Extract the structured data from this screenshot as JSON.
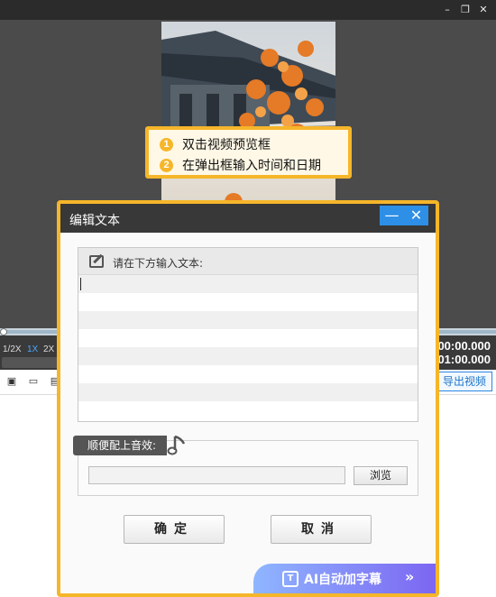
{
  "window": {
    "minimize_glyph": "–",
    "restore_glyph": "❐",
    "close_glyph": "✕"
  },
  "tip": {
    "steps": [
      {
        "num": "1",
        "text": "双击视频预览框"
      },
      {
        "num": "2",
        "text": "在弹出框输入时间和日期"
      }
    ],
    "accent_color": "#f6b62a"
  },
  "player": {
    "speeds": [
      "1/2X",
      "1X",
      "2X"
    ],
    "active_speed": "1X",
    "timecode_current": "00:00.000",
    "timecode_total": "01:00.000",
    "export_label": "导出视频"
  },
  "dialog": {
    "title": "编辑文本",
    "minimize_glyph": "—",
    "close_glyph": "✕",
    "text_prompt": "请在下方输入文本:",
    "text_value": "",
    "audio_label": "顺便配上音效:",
    "audio_value": "",
    "browse_label": "浏览",
    "ok_label": "确定",
    "cancel_label": "取消",
    "ai_label": "AI自动加字幕",
    "ai_icon_text": "T"
  }
}
